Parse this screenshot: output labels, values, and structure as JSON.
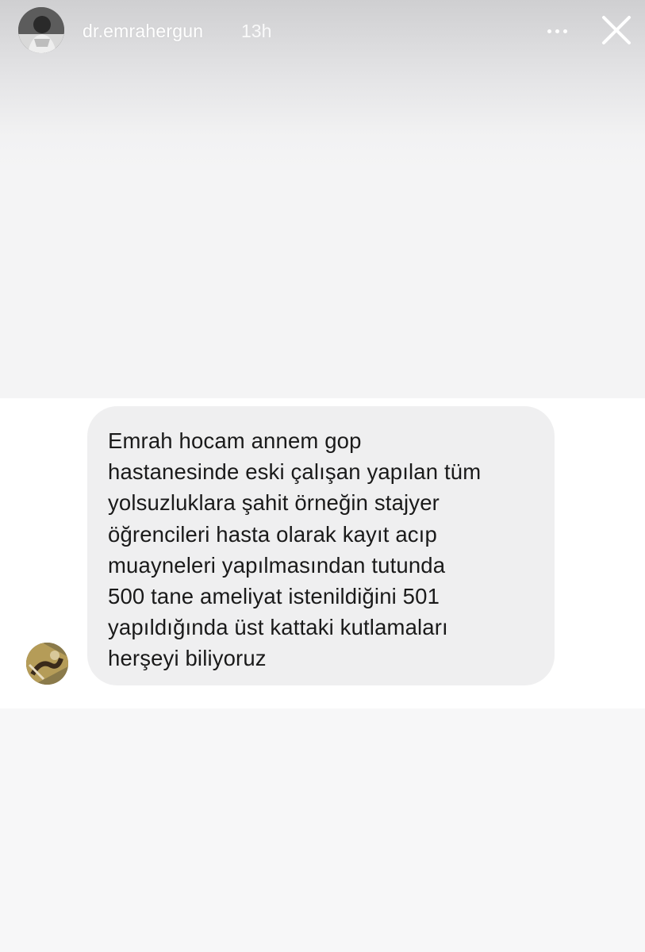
{
  "header": {
    "username": "dr.emrahergun",
    "timestamp": "13h",
    "avatar_icon": "profile-photo-icon",
    "more_icon": "more-horizontal-icon",
    "close_icon": "close-icon"
  },
  "message": {
    "sender_avatar_icon": "sender-profile-photo-icon",
    "text": "Emrah hocam annem gop\nhastanesinde eski çalışan yapılan tüm\nyolsuzluklara şahit örneğin stajyer\nöğrencileri hasta olarak kayıt acıp\nmuayneleri yapılmasından tutunda\n500 tane ameliyat istenildiğini 501\nyapıldığında üst kattaki kutlamaları\nherşeyi biliyoruz"
  },
  "colors": {
    "bubble": "#efeff0",
    "strip": "#ffffff",
    "background": "#f7f7f8",
    "header_text": "#ffffff"
  }
}
